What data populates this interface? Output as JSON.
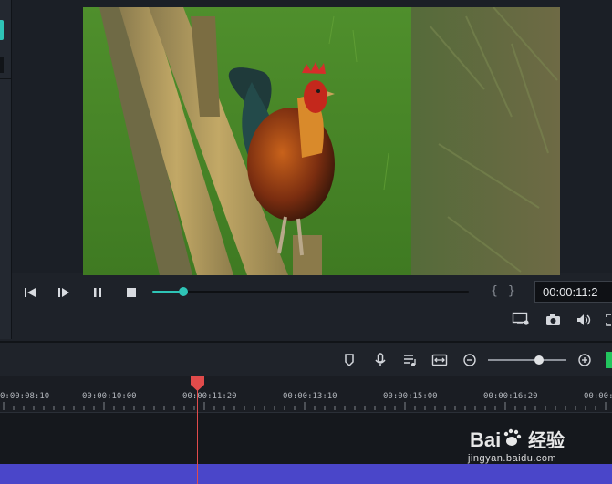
{
  "colors": {
    "accent": "#2ec4b6",
    "playhead": "#e04b4b",
    "audio_clip": "#4a46c9",
    "level_meter": "#22c55e"
  },
  "player": {
    "timecode": "00:00:11:2",
    "mark_in_glyph": "{",
    "mark_out_glyph": "}",
    "progress": 0.097,
    "icons": [
      "prev-frame-icon",
      "play-icon",
      "pause-icon",
      "stop-icon",
      "display-settings-icon",
      "snapshot-icon",
      "volume-icon",
      "fullscreen-icon"
    ]
  },
  "timeline": {
    "toolbar_icons": [
      "marker-icon",
      "voiceover-mic-icon",
      "audio-mixer-icon",
      "fit-to-timeline-icon",
      "zoom-out-icon",
      "zoom-in-icon"
    ],
    "zoom_level": 0.65,
    "ruler_labels": [
      "0:00:08:10",
      "00:00:10:00",
      "00:00:11:20",
      "00:00:13:10",
      "00:00:15:00",
      "00:00:16:20",
      "00:00:1"
    ]
  },
  "watermark": {
    "logo_text": "Bai",
    "logo_suffix": "经验",
    "url": "jingyan.baidu.com"
  }
}
